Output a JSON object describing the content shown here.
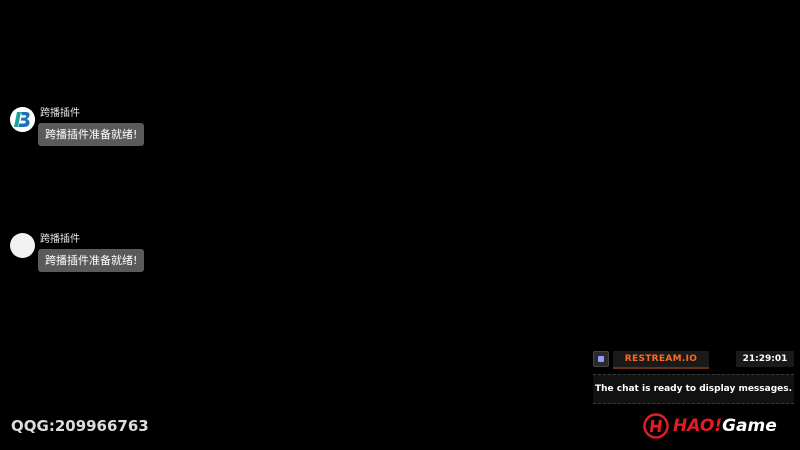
{
  "chat": {
    "messages": [
      {
        "sender": "跨播插件",
        "text": "跨播插件准备就绪!",
        "avatar": "b-logo-icon"
      },
      {
        "sender": "跨播插件",
        "text": "跨播插件准备就绪!",
        "avatar": "blank-avatar"
      }
    ]
  },
  "restream": {
    "brand": "RESTREAM.IO",
    "time": "21:29:01",
    "message": "The chat is ready to display messages.",
    "accent": "#ff6a1e"
  },
  "watermark": {
    "qq": "QQG:209966763"
  },
  "logo": {
    "prefix": "HAO!",
    "suffix": "Game",
    "brand_color": "#e31b23"
  }
}
